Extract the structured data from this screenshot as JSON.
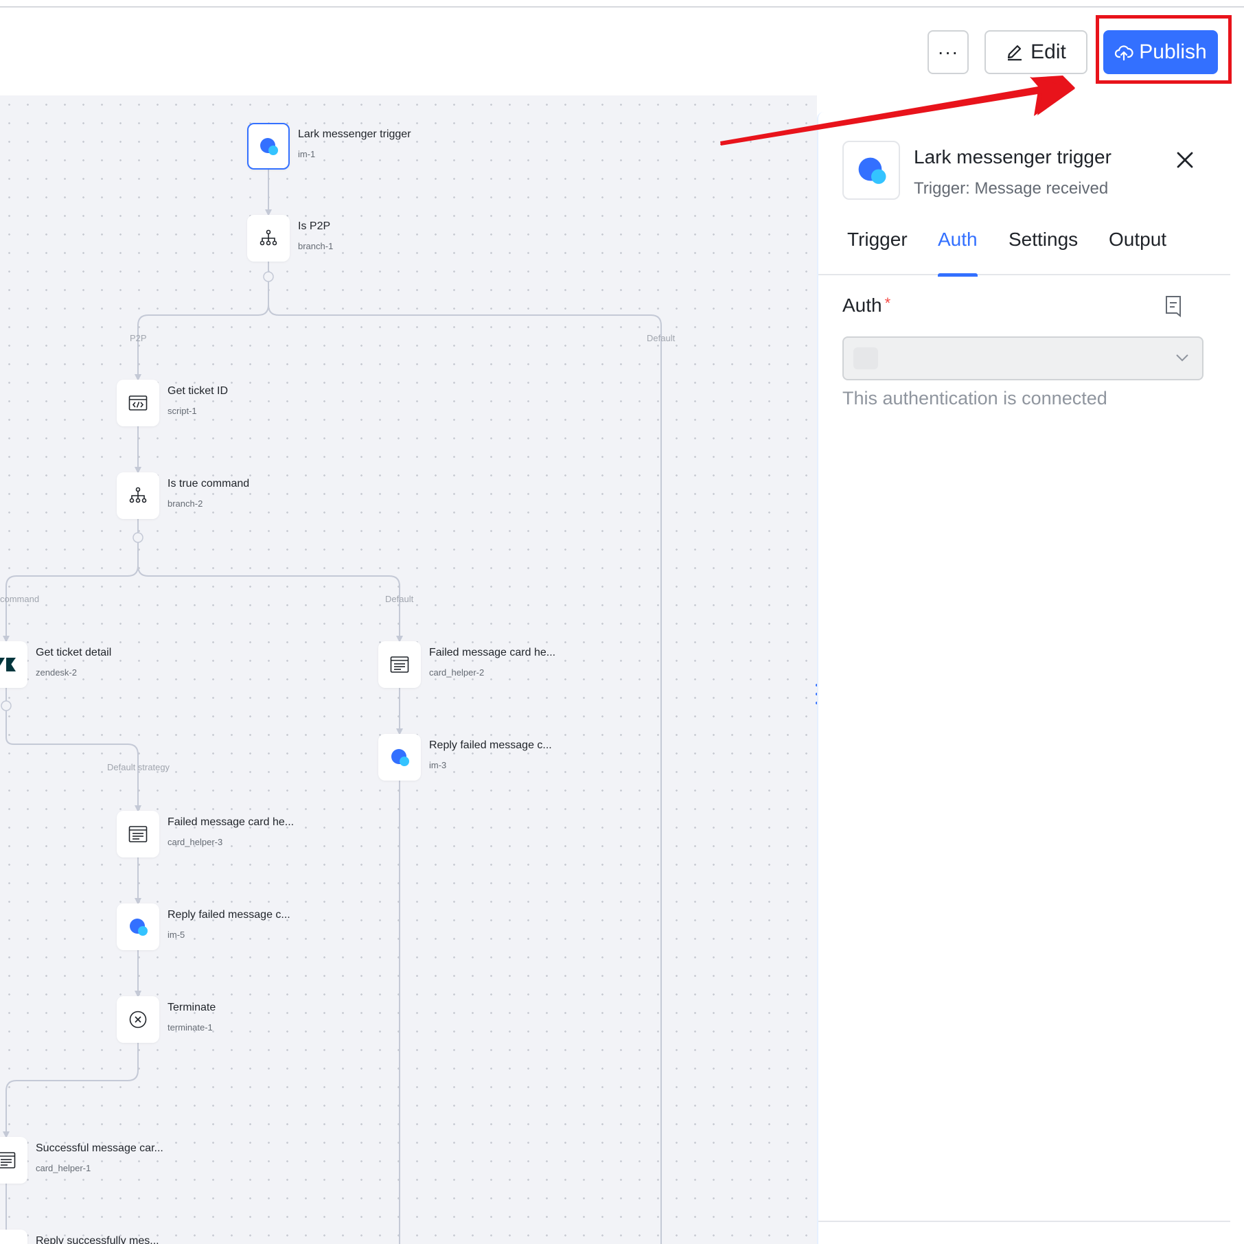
{
  "toolbar": {
    "more_label": "···",
    "edit_label": "Edit",
    "publish_label": "Publish"
  },
  "flow": {
    "nodes": [
      {
        "title": "Lark messenger trigger",
        "id": "im-1",
        "icon": "lark-messenger-icon"
      },
      {
        "title": "Is P2P",
        "id": "branch-1",
        "icon": "branch-icon"
      },
      {
        "title": "Get ticket ID",
        "id": "script-1",
        "icon": "code-icon"
      },
      {
        "title": "Is true command",
        "id": "branch-2",
        "icon": "branch-icon"
      },
      {
        "title": "Get ticket detail",
        "id": "zendesk-2",
        "icon": "zendesk-icon"
      },
      {
        "title": "Failed message card he...",
        "id": "card_helper-2",
        "icon": "card-icon"
      },
      {
        "title": "Reply failed message c...",
        "id": "im-3",
        "icon": "lark-messenger-icon"
      },
      {
        "title": "Failed message card he...",
        "id": "card_helper-3",
        "icon": "card-icon"
      },
      {
        "title": "Reply failed message c...",
        "id": "im-5",
        "icon": "lark-messenger-icon"
      },
      {
        "title": "Terminate",
        "id": "terminate-1",
        "icon": "terminate-icon"
      },
      {
        "title": "Successful message car...",
        "id": "card_helper-1",
        "icon": "card-icon"
      },
      {
        "title": "Reply successfully mes...",
        "id": "",
        "icon": "lark-messenger-icon"
      }
    ],
    "branch_labels": [
      "P2P",
      "Default",
      "command",
      "Default",
      "Default strategy"
    ]
  },
  "panel": {
    "title": "Lark messenger trigger",
    "subtitle": "Trigger: Message received",
    "tabs": [
      "Trigger",
      "Auth",
      "Settings",
      "Output"
    ],
    "active_tab": "Auth",
    "auth_label": "Auth",
    "required_mark": "*",
    "helper": "This authentication is connected"
  },
  "colors": {
    "accent": "#3370ff",
    "highlight": "#e8131b",
    "canvas_bg": "#f2f3f7"
  }
}
